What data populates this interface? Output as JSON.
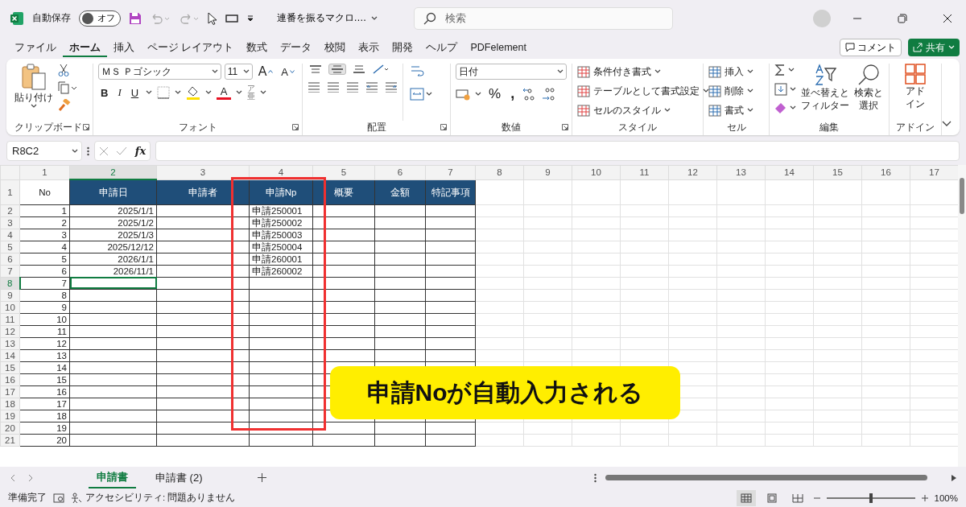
{
  "title_bar": {
    "autosave_label": "自動保存",
    "autosave": {
      "label": "オフ",
      "on": false
    },
    "document_title": "連番を振るマクロ.…",
    "search_placeholder": "検索"
  },
  "menu_tabs": [
    {
      "label": "ファイル",
      "selected": false
    },
    {
      "label": "ホーム",
      "selected": true
    },
    {
      "label": "挿入",
      "selected": false
    },
    {
      "label": "ページ レイアウト",
      "selected": false
    },
    {
      "label": "数式",
      "selected": false
    },
    {
      "label": "データ",
      "selected": false
    },
    {
      "label": "校閲",
      "selected": false
    },
    {
      "label": "表示",
      "selected": false
    },
    {
      "label": "開発",
      "selected": false
    },
    {
      "label": "ヘルプ",
      "selected": false
    },
    {
      "label": "PDFelement",
      "selected": false
    }
  ],
  "comment_button": "コメント",
  "share_button": "共有",
  "ribbon": {
    "clipboard": {
      "paste": "貼り付け",
      "label": "クリップボード"
    },
    "font": {
      "font_name": "ＭＳ Ｐゴシック",
      "font_size": "11",
      "grow": "A",
      "shrink": "A",
      "bold": "B",
      "italic": "I",
      "underline": "U",
      "font_color_letter": "A",
      "phonetic_top": "ア",
      "phonetic_bottom": "亜",
      "label": "フォント"
    },
    "alignment": {
      "vertical": [
        {
          "selected": false
        },
        {
          "selected": true
        },
        {
          "selected": false
        }
      ],
      "label": "配置"
    },
    "number": {
      "format": "日付",
      "percent": "%",
      "comma": ",",
      "label": "数値"
    },
    "styles": {
      "items": [
        "条件付き書式",
        "テーブルとして書式設定",
        "セルのスタイル"
      ],
      "label": "スタイル"
    },
    "cells": {
      "items": [
        "挿入",
        "削除",
        "書式"
      ],
      "label": "セル"
    },
    "editing": {
      "sort": "並べ替えとフィルター",
      "find": "検索と選択",
      "label": "編集"
    },
    "addins": {
      "button": "アドイン",
      "label": "アドイン"
    }
  },
  "formula_bar": {
    "name_box": "R8C2",
    "fx": "fx"
  },
  "sheet": {
    "columns": [
      {
        "label": "1",
        "selected": false
      },
      {
        "label": "2",
        "selected": true
      },
      {
        "label": "3",
        "selected": false
      },
      {
        "label": "4",
        "selected": false
      },
      {
        "label": "5",
        "selected": false
      },
      {
        "label": "6",
        "selected": false
      },
      {
        "label": "7",
        "selected": false
      },
      {
        "label": "8",
        "selected": false
      },
      {
        "label": "9",
        "selected": false
      },
      {
        "label": "10",
        "selected": false
      },
      {
        "label": "11",
        "selected": false
      },
      {
        "label": "12",
        "selected": false
      },
      {
        "label": "13",
        "selected": false
      },
      {
        "label": "14",
        "selected": false
      },
      {
        "label": "15",
        "selected": false
      },
      {
        "label": "16",
        "selected": false
      },
      {
        "label": "17",
        "selected": false
      }
    ],
    "rows": [
      {
        "number": "1",
        "kind": "header",
        "selected": false,
        "cells": [
          "No",
          "申請日",
          "申請者",
          "申請Np",
          "概要",
          "金額",
          "特記事項"
        ]
      },
      {
        "number": "2",
        "kind": "data",
        "selected": false,
        "no": "1",
        "date": "2025/1/1",
        "app_no": "申請250001"
      },
      {
        "number": "3",
        "kind": "data",
        "selected": false,
        "no": "2",
        "date": "2025/1/2",
        "app_no": "申請250002"
      },
      {
        "number": "4",
        "kind": "data",
        "selected": false,
        "no": "3",
        "date": "2025/1/3",
        "app_no": "申請250003"
      },
      {
        "number": "5",
        "kind": "data",
        "selected": false,
        "no": "4",
        "date": "2025/12/12",
        "app_no": "申請250004"
      },
      {
        "number": "6",
        "kind": "data",
        "selected": false,
        "no": "5",
        "date": "2026/1/1",
        "app_no": "申請260001"
      },
      {
        "number": "7",
        "kind": "data",
        "selected": false,
        "no": "6",
        "date": "2026/11/1",
        "app_no": "申請260002"
      },
      {
        "number": "8",
        "kind": "data",
        "selected": true,
        "no": "7"
      },
      {
        "number": "9",
        "kind": "data",
        "selected": false,
        "no": "8"
      },
      {
        "number": "10",
        "kind": "data",
        "selected": false,
        "no": "9"
      },
      {
        "number": "11",
        "kind": "data",
        "selected": false,
        "no": "10"
      },
      {
        "number": "12",
        "kind": "data",
        "selected": false,
        "no": "11"
      },
      {
        "number": "13",
        "kind": "data",
        "selected": false,
        "no": "12"
      },
      {
        "number": "14",
        "kind": "data",
        "selected": false,
        "no": "13"
      },
      {
        "number": "15",
        "kind": "data",
        "selected": false,
        "no": "14"
      },
      {
        "number": "16",
        "kind": "data",
        "selected": false,
        "no": "15"
      },
      {
        "number": "17",
        "kind": "data",
        "selected": false,
        "no": "16"
      },
      {
        "number": "18",
        "kind": "data",
        "selected": false,
        "no": "17"
      },
      {
        "number": "19",
        "kind": "data",
        "selected": false,
        "no": "18"
      },
      {
        "number": "20",
        "kind": "data",
        "selected": false,
        "no": "19"
      },
      {
        "number": "21",
        "kind": "data",
        "selected": false,
        "no": "20"
      }
    ]
  },
  "annotation": {
    "callout": "申請Noが自動入力される"
  },
  "sheet_tabs": [
    {
      "label": "申請書",
      "selected": true
    },
    {
      "label": "申請書 (2)",
      "selected": false
    }
  ],
  "status_bar": {
    "ready": "準備完了",
    "accessibility": "アクセシビリティ: 問題ありません",
    "views": [
      {
        "selected": true
      },
      {
        "selected": false
      },
      {
        "selected": false
      }
    ],
    "zoom": {
      "level": 0.5
    },
    "zoom_label": "100%"
  }
}
